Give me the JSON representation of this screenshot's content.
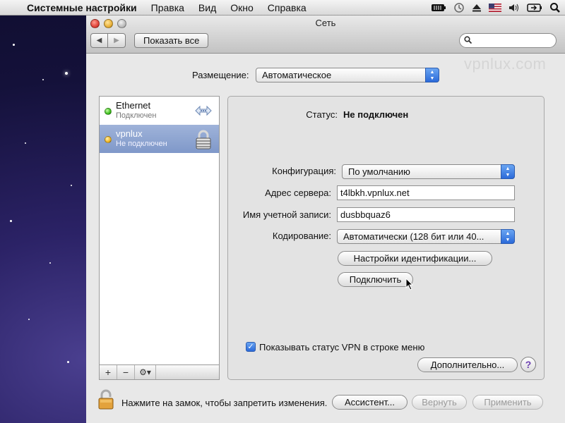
{
  "menubar": {
    "app": "Системные настройки",
    "items": [
      "Правка",
      "Вид",
      "Окно",
      "Справка"
    ]
  },
  "window": {
    "title": "Сеть",
    "show_all": "Показать все",
    "search_placeholder": "",
    "watermark": "vpnlux.com"
  },
  "location": {
    "label": "Размещение:",
    "value": "Автоматическое"
  },
  "services": [
    {
      "name": "Ethernet",
      "status": "Подключен",
      "status_color": "#3fbf1f",
      "icon": "ethernet-arrows-icon",
      "selected": false
    },
    {
      "name": "vpnlux",
      "status": "Не подключен",
      "status_color": "#f0b523",
      "icon": "lock-icon",
      "selected": true
    }
  ],
  "list_toolbar": {
    "add": "+",
    "remove": "−",
    "gear": "⚙▾"
  },
  "detail": {
    "status_label": "Статус:",
    "status_value": "Не подключен",
    "config_label": "Конфигурация:",
    "config_value": "По умолчанию",
    "server_label": "Адрес сервера:",
    "server_value": "t4lbkh.vpnlux.net",
    "account_label": "Имя учетной записи:",
    "account_value": "dusbbquaz6",
    "encryption_label": "Кодирование:",
    "encryption_value": "Автоматически (128 бит или 40...",
    "auth_button": "Настройки идентификации...",
    "connect_button": "Подключить",
    "show_vpn_status": "Показывать статус VPN в строке меню",
    "show_vpn_checked": true,
    "advanced_button": "Дополнительно...",
    "help": "?"
  },
  "bottom": {
    "lock_text": "Нажмите на замок, чтобы запретить изменения.",
    "assistant": "Ассистент...",
    "revert": "Вернуть",
    "apply": "Применить"
  },
  "colors": {
    "accent": "#2b6ad9",
    "selection": "#8aa2cf"
  }
}
